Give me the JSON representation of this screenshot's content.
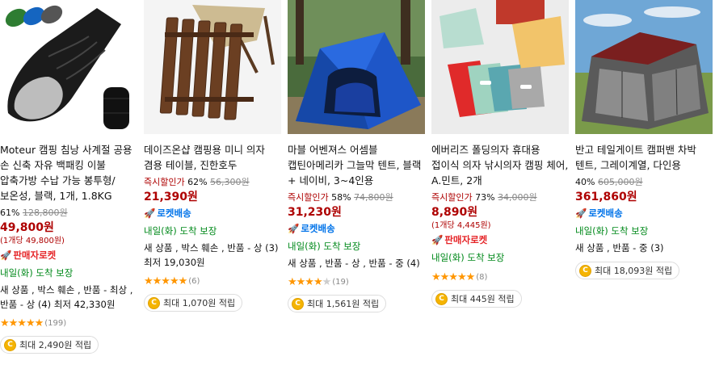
{
  "products": [
    {
      "title": "Moteur 캠핑 침낭 사계절 공용 손 신축 자유 백패킹 이불 압축가방 수납 가능 봉투형/보온성, 블랙, 1개, 1.8KG",
      "discount_label": "",
      "discount_rate": "61%",
      "original_price": "128,800원",
      "price": "49,800원",
      "unit_price": "(1개당 49,800원)",
      "badge": "판매자로켓",
      "badge_color": "#e52528",
      "arrival": "내일(화) 도착 보장",
      "options_text": "새 상품 , 박스 훼손 , 반품 - 최상 , 반품 - 상 (4) 최저 42,330원",
      "rating": 5,
      "review_count": "(199)",
      "reward": "최대 2,490원 적립",
      "image": "sleeping-bag"
    },
    {
      "title": "데이즈온샵 캠핑용 미니 의자 겸용 테이블, 진한호두",
      "discount_label": "즉시할인가",
      "discount_rate": "62%",
      "original_price": "56,300원",
      "price": "21,390원",
      "unit_price": "",
      "badge": "로켓배송",
      "badge_color": "#0073e9",
      "arrival": "내일(화) 도착 보장",
      "options_text": "새 상품 , 박스 훼손 , 반품 - 상 (3) 최저 19,030원",
      "rating": 5,
      "review_count": "(6)",
      "reward": "최대 1,070원 적립",
      "image": "wooden-stool"
    },
    {
      "title": "마블 어벤져스 어셈블 캡틴아메리카 그늘막 텐트, 블랙 + 네이비, 3~4인용",
      "discount_label": "즉시할인가",
      "discount_rate": "58%",
      "original_price": "74,800원",
      "price": "31,230원",
      "unit_price": "",
      "badge": "로켓배송",
      "badge_color": "#0073e9",
      "arrival": "내일(화) 도착 보장",
      "options_text": "새 상품 , 반품 - 상 , 반품 - 중 (4)",
      "rating": 4.5,
      "review_count": "(19)",
      "reward": "최대 1,561원 적립",
      "image": "blue-tent"
    },
    {
      "title": "에버리즈 폴딩의자 휴대용 접이식 의자 낚시의자 캠핑 체어, A.민트, 2개",
      "discount_label": "즉시할인가",
      "discount_rate": "73%",
      "original_price": "34,000원",
      "price": "8,890원",
      "unit_price": "(1개당 4,445원)",
      "badge": "판매자로켓",
      "badge_color": "#e52528",
      "arrival": "내일(화) 도착 보장",
      "options_text": "",
      "rating": 5,
      "review_count": "(8)",
      "reward": "최대 445원 적립",
      "image": "folding-chairs"
    },
    {
      "title": "반고 테일게이트 캠퍼밴 차박 텐트, 그레이계열, 다인용",
      "discount_label": "",
      "discount_rate": "40%",
      "original_price": "605,000원",
      "price": "361,860원",
      "unit_price": "",
      "badge": "로켓배송",
      "badge_color": "#0073e9",
      "arrival": "내일(화) 도착 보장",
      "options_text": "새 상품 , 반품 - 중 (3)",
      "rating": 0,
      "review_count": "",
      "reward": "최대 18,093원 적립",
      "image": "car-tent"
    }
  ]
}
